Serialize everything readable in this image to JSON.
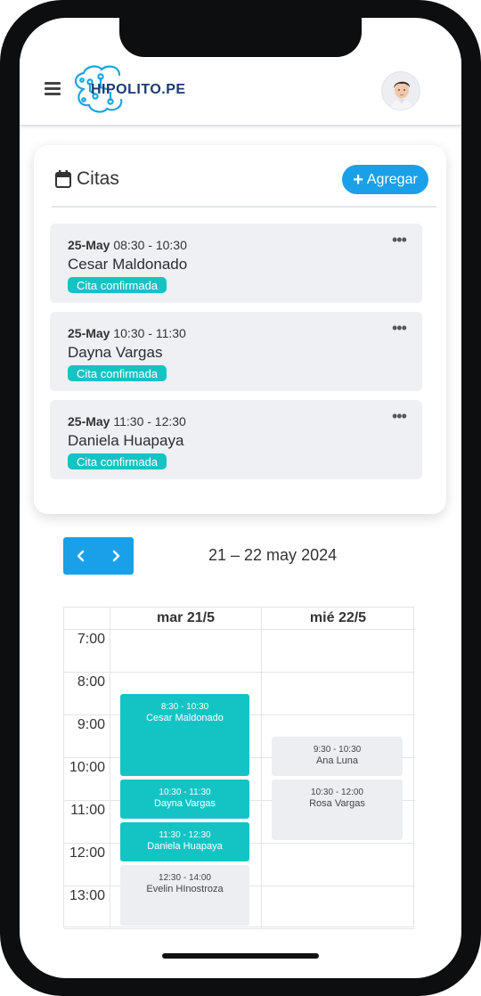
{
  "header": {
    "logo_text": "HIPOLITO.PE"
  },
  "citas": {
    "title": "Citas",
    "add_label": "Agregar",
    "items": [
      {
        "date": "25-May",
        "time": "08:30 - 10:30",
        "name": "Cesar Maldonado",
        "status": "Cita confirmada"
      },
      {
        "date": "25-May",
        "time": "10:30 - 11:30",
        "name": "Dayna Vargas",
        "status": "Cita confirmada"
      },
      {
        "date": "25-May",
        "time": "11:30 - 12:30",
        "name": "Daniela Huapaya",
        "status": "Cita confirmada"
      }
    ]
  },
  "calendar": {
    "range_title": "21 – 22 may 2024",
    "columns": [
      "mar 21/5",
      "mié 22/5"
    ],
    "hours": [
      "7:00",
      "8:00",
      "9:00",
      "10:00",
      "11:00",
      "12:00",
      "13:00"
    ],
    "events": [
      {
        "time": "8:30 - 10:30",
        "name": "Cesar Maldonado",
        "day": 0,
        "start": 8.5,
        "end": 10.5,
        "color": "#14c4c4"
      },
      {
        "time": "10:30 - 11:30",
        "name": "Dayna Vargas",
        "day": 0,
        "start": 10.5,
        "end": 11.5,
        "color": "#14c4c4"
      },
      {
        "time": "11:30 - 12:30",
        "name": "Daniela Huapaya",
        "day": 0,
        "start": 11.5,
        "end": 12.5,
        "color": "#14c4c4"
      },
      {
        "time": "12:30 - 14:00",
        "name": "Evelin HInostroza",
        "day": 0,
        "start": 12.5,
        "end": 14,
        "color": "#eceef2"
      },
      {
        "time": "9:30 - 10:30",
        "name": "Ana Luna",
        "day": 1,
        "start": 9.5,
        "end": 10.5,
        "color": "#eceef2"
      },
      {
        "time": "10:30 - 12:00",
        "name": "Rosa Vargas",
        "day": 1,
        "start": 10.5,
        "end": 12,
        "color": "#eceef2"
      }
    ]
  },
  "colors": {
    "accent": "#1aa0e8",
    "confirmed": "#14c4c4",
    "pending": "#eceef2"
  }
}
